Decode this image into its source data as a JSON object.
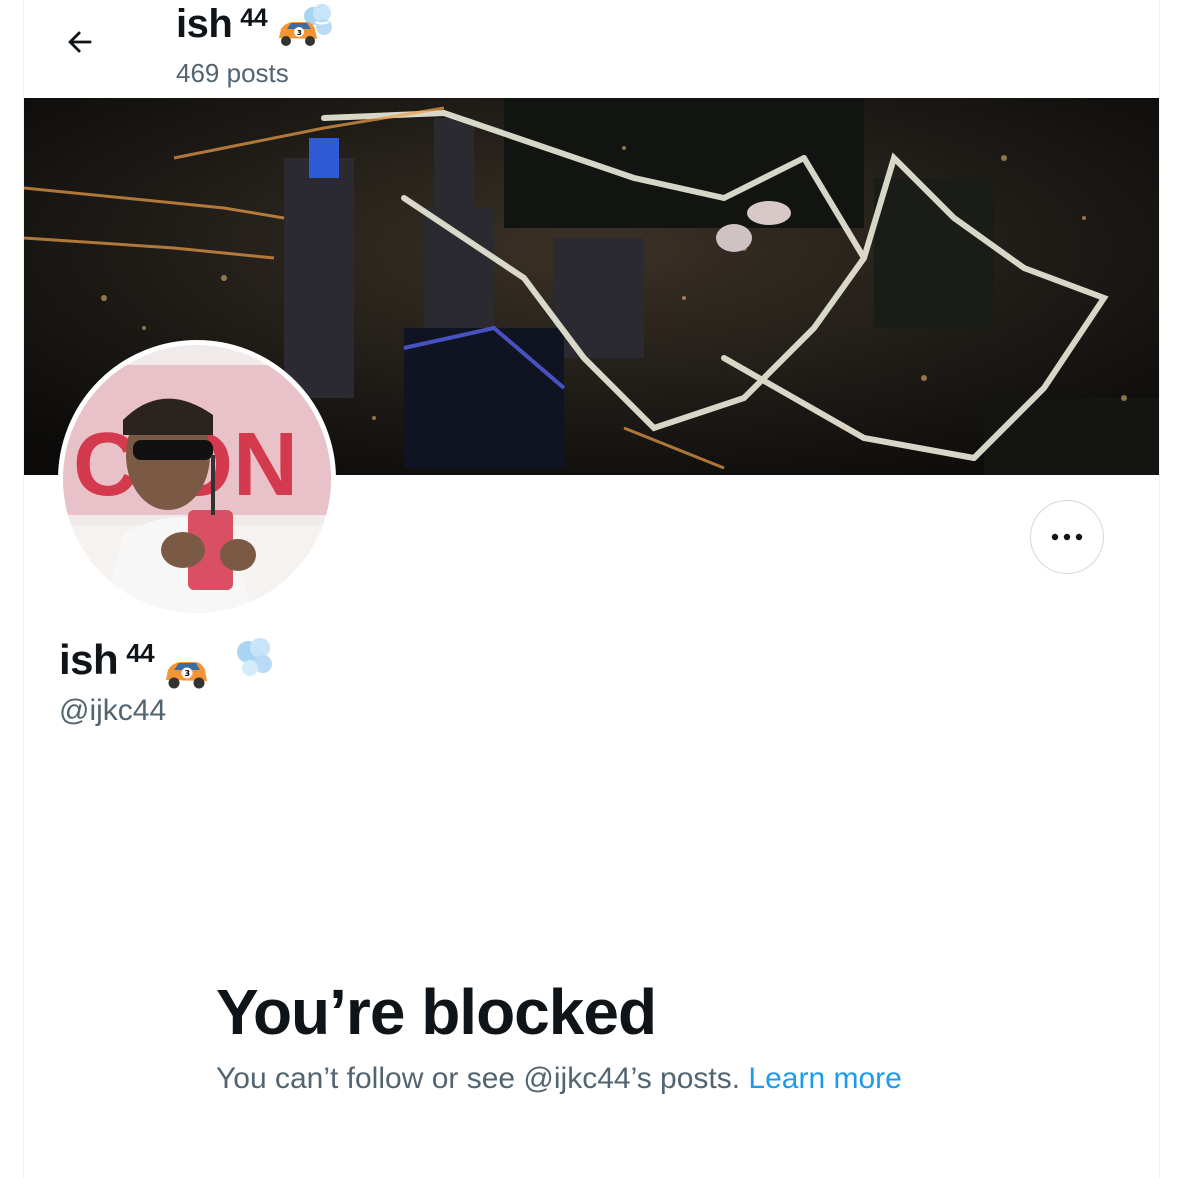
{
  "header": {
    "name": "ish",
    "name_sup": "44",
    "posts_count": "469 posts"
  },
  "profile": {
    "name": "ish",
    "name_sup": "44",
    "handle": "@ijkc44",
    "emoji": [
      "race-car-number-3-emoji",
      "dash-emoji"
    ]
  },
  "banner": {
    "description_icon": "night-city-aerial-image"
  },
  "blocked": {
    "title": "You’re blocked",
    "message": "You can’t follow or see @ijkc44’s posts. ",
    "link": "Learn more"
  },
  "colors": {
    "link": "#1d9bf0",
    "secondary_text": "#536471",
    "primary_text": "#0f1419",
    "border": "#cfd9de"
  }
}
